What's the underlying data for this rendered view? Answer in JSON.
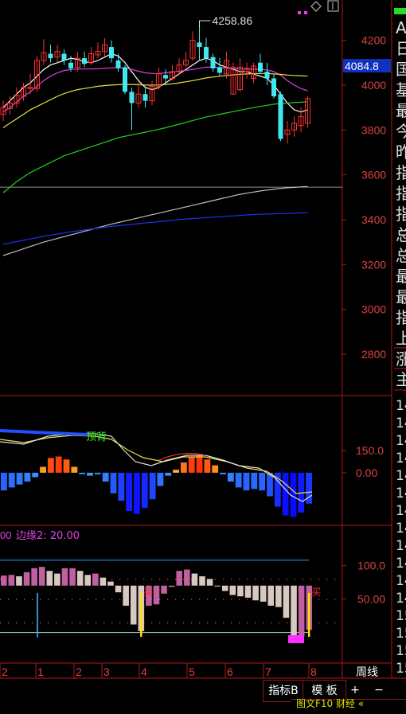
{
  "chart_data": [
    {
      "type": "candlestick",
      "title": "",
      "y_ticks": [
        4200,
        4000,
        3800,
        3600,
        3400,
        3200,
        3000,
        2800
      ],
      "ylim": [
        2640,
        4330
      ],
      "current_price_label": "4084.8",
      "current_price": 4084.8,
      "high_marker_label": "4258.86",
      "high_marker_value": 4258.86,
      "reference_line_value": 3545,
      "candles": [
        {
          "o": 3870,
          "c": 3900,
          "h": 3930,
          "l": 3840,
          "color": "red"
        },
        {
          "o": 3895,
          "c": 3920,
          "h": 3950,
          "l": 3870,
          "color": "red"
        },
        {
          "o": 3920,
          "c": 3955,
          "h": 3990,
          "l": 3900,
          "color": "red"
        },
        {
          "o": 3950,
          "c": 3990,
          "h": 4010,
          "l": 3930,
          "color": "red"
        },
        {
          "o": 3985,
          "c": 3990,
          "h": 4050,
          "l": 3960,
          "color": "red"
        },
        {
          "o": 3985,
          "c": 4110,
          "h": 4130,
          "l": 3970,
          "color": "red"
        },
        {
          "o": 4110,
          "c": 4145,
          "h": 4205,
          "l": 4090,
          "color": "red"
        },
        {
          "o": 4140,
          "c": 4120,
          "h": 4180,
          "l": 4100,
          "color": "cyan"
        },
        {
          "o": 4125,
          "c": 4150,
          "h": 4180,
          "l": 4100,
          "color": "red"
        },
        {
          "o": 4140,
          "c": 4110,
          "h": 4160,
          "l": 4090,
          "color": "cyan"
        },
        {
          "o": 4100,
          "c": 4075,
          "h": 4130,
          "l": 4060,
          "color": "cyan"
        },
        {
          "o": 4080,
          "c": 4120,
          "h": 4150,
          "l": 4060,
          "color": "red"
        },
        {
          "o": 4120,
          "c": 4095,
          "h": 4150,
          "l": 4080,
          "color": "cyan"
        },
        {
          "o": 4100,
          "c": 4140,
          "h": 4170,
          "l": 4090,
          "color": "red"
        },
        {
          "o": 4135,
          "c": 4150,
          "h": 4190,
          "l": 4120,
          "color": "red"
        },
        {
          "o": 4150,
          "c": 4180,
          "h": 4210,
          "l": 4130,
          "color": "red"
        },
        {
          "o": 4170,
          "c": 4120,
          "h": 4200,
          "l": 4100,
          "color": "cyan"
        },
        {
          "o": 4110,
          "c": 4075,
          "h": 4140,
          "l": 4060,
          "color": "cyan"
        },
        {
          "o": 4080,
          "c": 3970,
          "h": 4090,
          "l": 3960,
          "color": "cyan"
        },
        {
          "o": 3970,
          "c": 3920,
          "h": 3990,
          "l": 3800,
          "color": "cyan"
        },
        {
          "o": 3920,
          "c": 3960,
          "h": 4010,
          "l": 3900,
          "color": "red"
        },
        {
          "o": 3960,
          "c": 3930,
          "h": 3990,
          "l": 3900,
          "color": "cyan"
        },
        {
          "o": 3930,
          "c": 3995,
          "h": 4020,
          "l": 3910,
          "color": "red"
        },
        {
          "o": 3995,
          "c": 4050,
          "h": 4080,
          "l": 3980,
          "color": "red"
        },
        {
          "o": 4045,
          "c": 4030,
          "h": 4070,
          "l": 4010,
          "color": "cyan"
        },
        {
          "o": 4030,
          "c": 4060,
          "h": 4090,
          "l": 4020,
          "color": "red"
        },
        {
          "o": 4060,
          "c": 4090,
          "h": 4120,
          "l": 4050,
          "color": "red"
        },
        {
          "o": 4090,
          "c": 4110,
          "h": 4150,
          "l": 4080,
          "color": "red"
        },
        {
          "o": 4120,
          "c": 4200,
          "h": 4240,
          "l": 4110,
          "color": "red"
        },
        {
          "o": 4190,
          "c": 4170,
          "h": 4258.86,
          "l": 4110,
          "color": "cyan"
        },
        {
          "o": 4170,
          "c": 4120,
          "h": 4210,
          "l": 4100,
          "color": "cyan"
        },
        {
          "o": 4125,
          "c": 4075,
          "h": 4140,
          "l": 4060,
          "color": "cyan"
        },
        {
          "o": 4080,
          "c": 4055,
          "h": 4120,
          "l": 4040,
          "color": "cyan"
        },
        {
          "o": 4050,
          "c": 4110,
          "h": 4150,
          "l": 4030,
          "color": "red"
        },
        {
          "o": 4080,
          "c": 3960,
          "h": 4100,
          "l": 3960,
          "color": "red"
        },
        {
          "o": 3980,
          "c": 4080,
          "h": 4120,
          "l": 3970,
          "color": "red"
        },
        {
          "o": 4075,
          "c": 4060,
          "h": 4100,
          "l": 4030,
          "color": "red"
        },
        {
          "o": 4085,
          "c": 4030,
          "h": 4100,
          "l": 4010,
          "color": "red"
        },
        {
          "o": 4060,
          "c": 4100,
          "h": 4140,
          "l": 4050,
          "color": "cyan"
        },
        {
          "o": 4060,
          "c": 4030,
          "h": 4100,
          "l": 4000,
          "color": "cyan"
        },
        {
          "o": 4030,
          "c": 3950,
          "h": 4050,
          "l": 3940,
          "color": "cyan"
        },
        {
          "o": 3960,
          "c": 3760,
          "h": 3970,
          "l": 3750,
          "color": "cyan"
        },
        {
          "o": 3780,
          "c": 3800,
          "h": 3840,
          "l": 3740,
          "color": "red"
        },
        {
          "o": 3800,
          "c": 3830,
          "h": 3860,
          "l": 3770,
          "color": "red"
        },
        {
          "o": 3820,
          "c": 3860,
          "h": 3900,
          "l": 3790,
          "color": "red"
        },
        {
          "o": 3830,
          "c": 3940,
          "h": 3950,
          "l": 3810,
          "color": "red"
        }
      ],
      "series": [
        {
          "color": "#ffffff",
          "values": [
            3900,
            3930,
            3960,
            3990,
            4010,
            4040,
            4070,
            4090,
            4100,
            4110,
            4120,
            4115,
            4105,
            4100,
            4110,
            4125,
            4140,
            4130,
            4100,
            4060,
            4020,
            3990,
            3980,
            3990,
            4010,
            4030,
            4050,
            4070,
            4090,
            4110,
            4120,
            4110,
            4090,
            4080,
            4070,
            4060,
            4060,
            4050,
            4040,
            4030,
            4000,
            3960,
            3920,
            3890,
            3880,
            3890
          ]
        },
        {
          "color": "#e040e0",
          "values": [
            3880,
            3900,
            3925,
            3950,
            3970,
            3995,
            4020,
            4040,
            4055,
            4065,
            4070,
            4072,
            4072,
            4072,
            4073,
            4075,
            4077,
            4078,
            4075,
            4070,
            4062,
            4055,
            4052,
            4052,
            4055,
            4058,
            4062,
            4066,
            4070,
            4075,
            4080,
            4080,
            4078,
            4076,
            4074,
            4072,
            4072,
            4071,
            4070,
            4068,
            4060,
            4045,
            4020,
            4000,
            3985,
            3975
          ]
        },
        {
          "color": "#e8e040",
          "values": [
            3810,
            3830,
            3850,
            3870,
            3890,
            3905,
            3920,
            3935,
            3950,
            3962,
            3972,
            3980,
            3985,
            3990,
            3995,
            3998,
            4000,
            4002,
            4003,
            4003,
            4002,
            4000,
            4000,
            4001,
            4003,
            4006,
            4010,
            4015,
            4020,
            4026,
            4032,
            4036,
            4040,
            4043,
            4046,
            4048,
            4050,
            4051,
            4052,
            4052,
            4050,
            4048,
            4045,
            4043,
            4042,
            4040
          ]
        },
        {
          "color": "#20d020",
          "values": [
            3520,
            3545,
            3570,
            3590,
            3610,
            3625,
            3640,
            3655,
            3670,
            3685,
            3695,
            3705,
            3715,
            3725,
            3735,
            3745,
            3755,
            3765,
            3772,
            3778,
            3784,
            3790,
            3796,
            3803,
            3810,
            3818,
            3826,
            3834,
            3842,
            3850,
            3858,
            3864,
            3870,
            3876,
            3882,
            3888,
            3894,
            3900,
            3905,
            3910,
            3915,
            3918,
            3920,
            3922,
            3924,
            3926
          ]
        },
        {
          "color": "#c0c0c0",
          "values": [
            3240,
            3250,
            3260,
            3270,
            3280,
            3290,
            3300,
            3308,
            3316,
            3324,
            3332,
            3340,
            3348,
            3356,
            3364,
            3372,
            3380,
            3387,
            3394,
            3401,
            3408,
            3415,
            3422,
            3429,
            3436,
            3443,
            3450,
            3457,
            3464,
            3471,
            3478,
            3485,
            3492,
            3499,
            3506,
            3513,
            3518,
            3523,
            3528,
            3532,
            3536,
            3539,
            3542,
            3544,
            3546,
            3548
          ]
        },
        {
          "color": "#2030f0",
          "values": [
            3290,
            3296,
            3302,
            3308,
            3314,
            3320,
            3326,
            3331,
            3336,
            3341,
            3346,
            3350,
            3354,
            3358,
            3362,
            3366,
            3370,
            3373,
            3376,
            3379,
            3382,
            3385,
            3388,
            3391,
            3394,
            3397,
            3400,
            3403,
            3405,
            3407,
            3409,
            3411,
            3413,
            3415,
            3417,
            3419,
            3421,
            3423,
            3424,
            3425,
            3426,
            3427,
            3428,
            3429,
            3430,
            3431
          ]
        }
      ]
    },
    {
      "type": "macd",
      "y_ticks": [
        150.0,
        0.0
      ],
      "y_tick_labels": [
        "150.0",
        "0.00"
      ],
      "ylim": [
        -330,
        480
      ],
      "annotation": "顶背",
      "histogram": [
        -120,
        -100,
        -80,
        -60,
        -30,
        40,
        100,
        110,
        90,
        40,
        -10,
        -20,
        -10,
        -60,
        -140,
        -190,
        -260,
        -280,
        -240,
        -180,
        -90,
        -20,
        20,
        70,
        110,
        120,
        90,
        50,
        -10,
        -60,
        -100,
        -120,
        -110,
        -120,
        -160,
        -230,
        -290,
        -300,
        -270,
        -210
      ]
    },
    {
      "type": "oscillator",
      "y_ticks": [
        100.0,
        50.0
      ],
      "y_tick_labels": [
        "100.0",
        "50.00"
      ],
      "ylim": [
        -42,
        154
      ],
      "upper_line": 108,
      "lower_line": 0,
      "values": [
        85,
        86,
        84,
        90,
        96,
        98,
        92,
        88,
        96,
        96,
        92,
        86,
        88,
        82,
        76,
        60,
        40,
        12,
        2,
        40,
        42,
        58,
        68,
        92,
        94,
        88,
        84,
        80,
        70,
        62,
        56,
        54,
        52,
        48,
        46,
        40,
        38,
        22,
        -8,
        -6,
        4
      ],
      "buy_signals": [
        18,
        40
      ],
      "signal_label": "买",
      "indicator_label": "边缘2: 20.00",
      "partial_label": "00"
    }
  ],
  "x_axis": {
    "labels": [
      "2",
      "1",
      "2",
      "3",
      "4",
      "5",
      "6",
      "7",
      "8"
    ],
    "last_label": "周线"
  },
  "toolbar": {
    "indicator_tab": "指标B",
    "template_tab": "模 板",
    "plus": "+",
    "minus": "−"
  },
  "bottom_bar": {
    "text": "图文F10 财经 «"
  },
  "sidebar": {
    "chars": [
      "A",
      "日",
      "国",
      "基",
      "最",
      "今",
      "昨",
      "指",
      "指",
      "指",
      "总",
      "总",
      "最",
      "最",
      "指",
      "上",
      "涨",
      "主"
    ],
    "nums": [
      "14",
      "14",
      "14",
      "14",
      "14",
      "14",
      "14",
      "14",
      "14",
      "14",
      "14",
      "14",
      "15",
      "15",
      "15",
      "15"
    ]
  },
  "colors": {
    "up": "#ff3030",
    "down": "#40e8f0",
    "axis": "#c02020",
    "price_box": "#1030c0"
  }
}
